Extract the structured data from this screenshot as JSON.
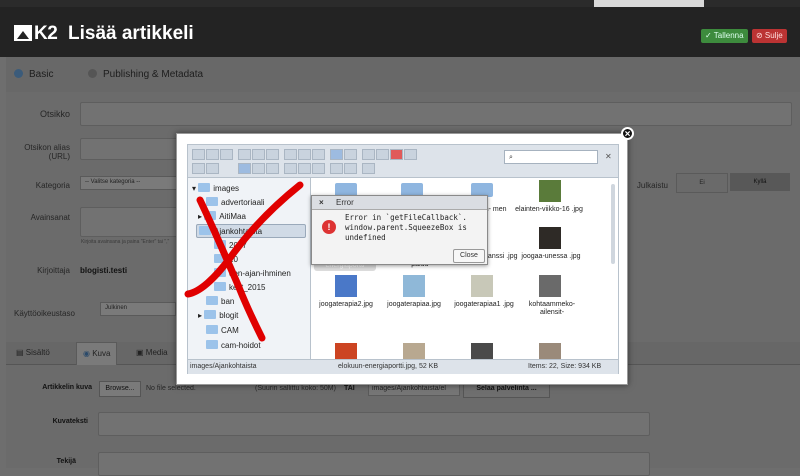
{
  "header": {
    "logo_text": "K2",
    "title": "Lisää artikkeli",
    "save_label": "✓ Tallenna",
    "close_label": "⊘ Sulje"
  },
  "tabs": [
    {
      "label": "Basic"
    },
    {
      "label": "Publishing & Metadata"
    }
  ],
  "form": {
    "title_label": "Otsikko",
    "alias_label": "Otsikon alias (URL)",
    "category_label": "Kategoria",
    "category_value": "-- Valitse kategoria --",
    "published_label": "Julkaistu",
    "published_options": [
      "Ei",
      "Kyllä"
    ],
    "tags_label": "Avainsanat",
    "tags_hint": "Kirjoita avainsana ja paina \"Enter\" tai \",\"",
    "author_label": "Kirjoittaja",
    "author_value": "blogisti.testi",
    "access_label": "Käyttöoikeustaso",
    "access_value": "Julkinen",
    "image_tabs": [
      "Sisältö",
      "Kuva",
      "Media"
    ],
    "image_label": "Artikkelin kuva",
    "browse_label": "Browse...",
    "no_file_label": "No file selected.",
    "max_size_label": "(Suurin sallittu koko: 50M)",
    "or_label": "TAI",
    "path_value": "images/Ajankohtaista/el",
    "server_browse_label": "Selaa palvelinta ...",
    "caption_label": "Kuvateksti",
    "credits_label": "Tekijä"
  },
  "file_manager": {
    "search_value": "",
    "tree": [
      {
        "label": "images"
      },
      {
        "label": "advertoriaali"
      },
      {
        "label": "AitiMaa"
      },
      {
        "label": "Ajankohtaista"
      },
      {
        "label": "2017"
      },
      {
        "label": "20"
      },
      {
        "label": "den-ajan-ihminen"
      },
      {
        "label": "kelit_2015"
      },
      {
        "label": "ban"
      },
      {
        "label": "blogit"
      },
      {
        "label": "CAM"
      },
      {
        "label": "cam-hoidot"
      }
    ],
    "files": [
      {
        "name": "",
        "kind": "folder"
      },
      {
        "name": "",
        "kind": "folder"
      },
      {
        "name": "",
        "kind": "folder"
      },
      {
        "name": "elainten-viikko-16 .jpg",
        "kind": "image"
      },
      {
        "name": "ajan- men",
        "kind": "image"
      },
      {
        "name": "",
        "kind": "image"
      },
      {
        "name": "elokuun-energiaportti",
        "kind": "image"
      },
      {
        "name": "henkisyyden-pk-paluu-",
        "kind": "image"
      },
      {
        "name": "hohtava-oranssi .jpg",
        "kind": "image"
      },
      {
        "name": "joogaa-unessa .jpg",
        "kind": "image"
      },
      {
        "name": "joogaterapia2.jpg",
        "kind": "image"
      },
      {
        "name": "joogaterapiaa.jpg",
        "kind": "image"
      },
      {
        "name": "joogaterapiaa1 .jpg",
        "kind": "image"
      },
      {
        "name": "kohtaammeko- ailensit-",
        "kind": "image"
      }
    ],
    "status_path": "images/Ajankohtaista",
    "status_file": "elokuun-energiaportti.jpg, 52 KB",
    "status_items": "Items: 22, Size: 934 KB"
  },
  "error_dialog": {
    "title": "Error",
    "message": "Error in `getFileCallback`. window.parent.SqueezeBox is undefined",
    "close_label": "Close"
  },
  "colors": {
    "header_bg": "#232323",
    "save_green": "#3d8b3d",
    "close_red": "#b33",
    "annotation_red": "#e00000"
  }
}
